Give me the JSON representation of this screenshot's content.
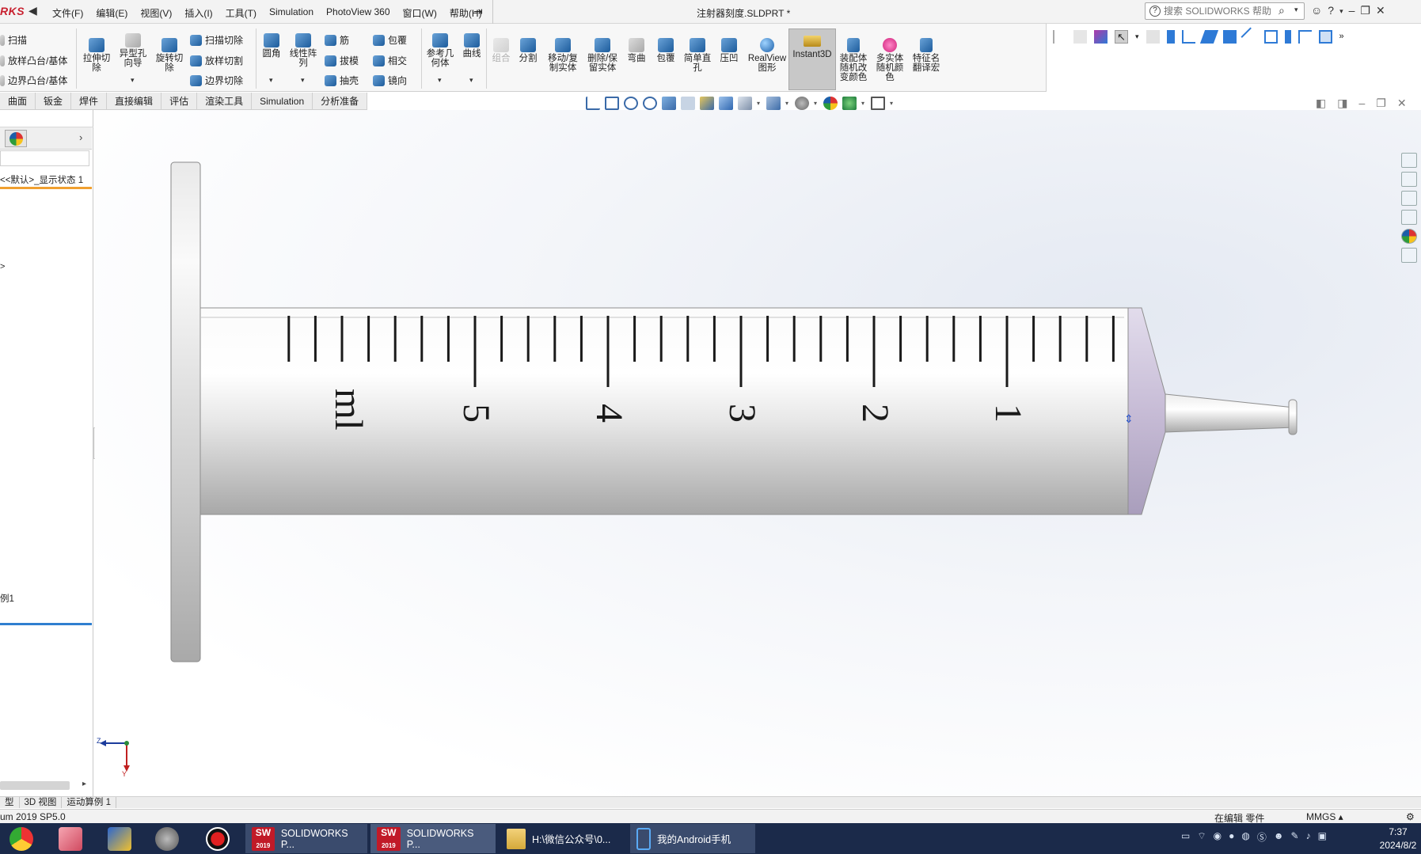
{
  "app": {
    "logo": "RKS",
    "document_title": "注射器刻度.SLDPRT *",
    "search_placeholder": "搜索 SOLIDWORKS 帮助"
  },
  "menu": [
    "文件(F)",
    "编辑(E)",
    "视图(V)",
    "插入(I)",
    "工具(T)",
    "Simulation",
    "PhotoView 360",
    "窗口(W)",
    "帮助(H)"
  ],
  "ribbon": {
    "left_small": [
      "扫描",
      "放样凸台/基体",
      "边界凸台/基体"
    ],
    "cut_big": [
      "拉伸切\n除",
      "异型孔\n向导",
      "旋转切\n除"
    ],
    "cut_small": [
      "扫描切除",
      "放样切割",
      "边界切除"
    ],
    "fillet": "圆角",
    "pattern": "线性阵\n列",
    "feat_small_1": [
      "筋",
      "拔模",
      "抽壳"
    ],
    "feat_small_2": [
      "包覆",
      "相交",
      "镜向"
    ],
    "ref_geom": "参考几\n何体",
    "curves": "曲线",
    "combine": "组合",
    "split": "分割",
    "move_copy": "移动/复\n制实体",
    "delete_keep": "删除/保\n留实体",
    "flex": "弯曲",
    "wrap": "包覆",
    "simple_hole": "简单直\n孔",
    "indent": "压凹",
    "realview": "RealView\n图形",
    "instant3d": "Instant3D",
    "assy_color": "装配体\n随机改\n变颜色",
    "multi_color": "多实体\n随机颜\n色",
    "feat_translate": "特征名\n翻译宏"
  },
  "tabs": [
    "曲面",
    "钣金",
    "焊件",
    "直接编辑",
    "评估",
    "渲染工具",
    "Simulation",
    "分析准备"
  ],
  "left_panel": {
    "config": "<<默认>_显示状态 1",
    "arrow": ">",
    "item": "例1"
  },
  "bottom_tabs": [
    "型",
    "3D 视图",
    "运动算例 1"
  ],
  "status": {
    "version": "um 2019 SP5.0",
    "mode": "在编辑 零件",
    "units": "MMGS"
  },
  "model": {
    "scale_labels": [
      "1",
      "2",
      "3",
      "4",
      "5"
    ],
    "unit_label": "ml",
    "minor_ticks_per_unit": 5,
    "barrel_color": "#c9c9c9",
    "tip_color": "#b7a9c8"
  },
  "triad": {
    "z": "Z",
    "y": "Y"
  },
  "taskbar": {
    "apps": [
      "SOLIDWORKS P...",
      "SOLIDWORKS P...",
      "H:\\微信公众号\\0...",
      "我的Android手机"
    ],
    "badges": [
      "2019",
      "2019"
    ],
    "time": "7:37",
    "date": "2024/8/2"
  },
  "colors": {
    "accent": "#c8202f",
    "taskbar": "#1b2a4a",
    "config_underline": "#f0a030"
  }
}
